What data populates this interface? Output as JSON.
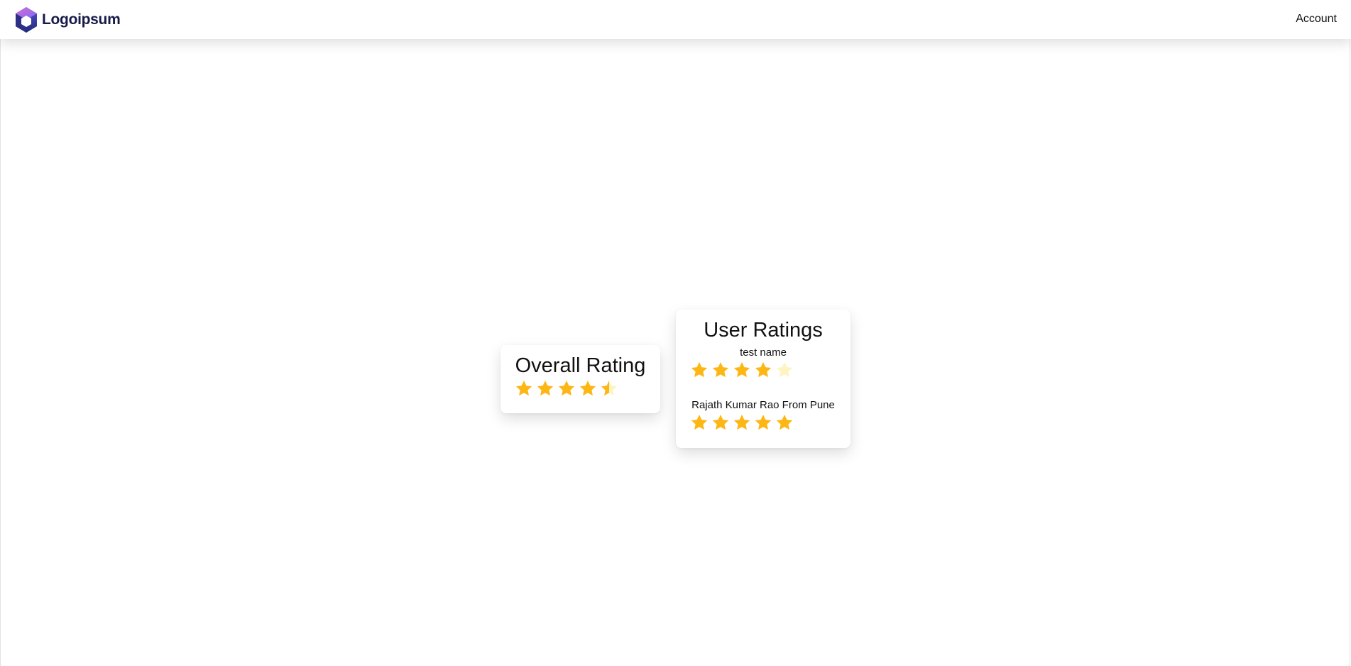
{
  "navbar": {
    "brand_name": "Logoipsum",
    "brand_icon": "hexagon-cube-logo-icon",
    "account_label": "Account"
  },
  "colors": {
    "star_filled": "#FDB714",
    "star_empty": "#FEF3C2",
    "brand_text": "#171A48"
  },
  "overall_rating": {
    "title": "Overall Rating",
    "rating": 4.5,
    "max": 5
  },
  "user_ratings": {
    "title": "User Ratings",
    "reviews": [
      {
        "name": "test name",
        "rating": 4,
        "max": 5
      },
      {
        "name": "Rajath Kumar Rao From Pune",
        "rating": 5,
        "max": 5
      }
    ]
  }
}
